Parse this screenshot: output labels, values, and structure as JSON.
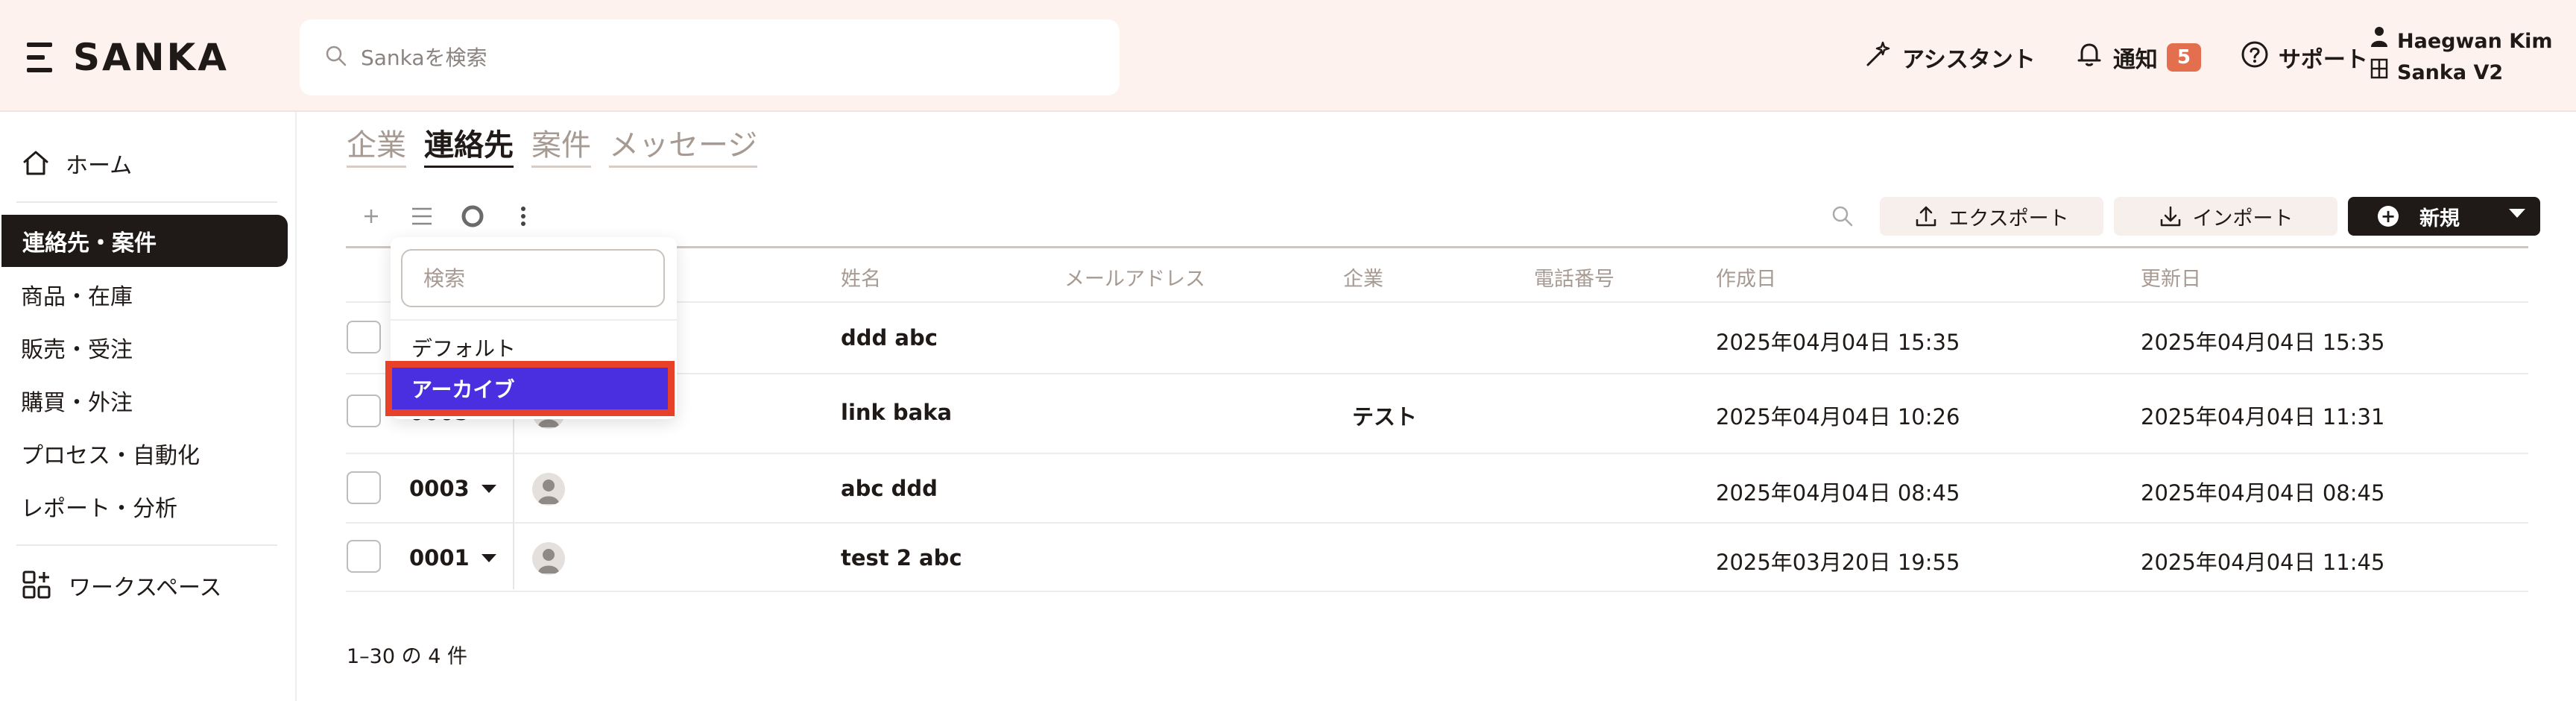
{
  "app": {
    "logo_text": "SANKA"
  },
  "header": {
    "search_placeholder": "Sankaを検索",
    "assistant_label": "アシスタント",
    "notifications_label": "通知",
    "notifications_count": "5",
    "support_label": "サポート",
    "user_name": "Haegwan Kim",
    "workspace_name": "Sanka V2"
  },
  "sidebar": {
    "items": [
      {
        "label": "ホーム"
      },
      {
        "label": "連絡先・案件"
      },
      {
        "label": "商品・在庫"
      },
      {
        "label": "販売・受注"
      },
      {
        "label": "購買・外注"
      },
      {
        "label": "プロセス・自動化"
      },
      {
        "label": "レポート・分析"
      },
      {
        "label": "ワークスペース"
      }
    ]
  },
  "tabs": [
    {
      "label": "企業"
    },
    {
      "label": "連絡先"
    },
    {
      "label": "案件"
    },
    {
      "label": "メッセージ"
    }
  ],
  "toolbar": {
    "export_label": "エクスポート",
    "import_label": "インポート",
    "new_label": "新規"
  },
  "table": {
    "columns": [
      "姓名",
      "メールアドレス",
      "企業",
      "電話番号",
      "作成日",
      "更新日"
    ],
    "rows": [
      {
        "id": "",
        "name": "ddd abc",
        "email": "",
        "company": "",
        "phone": "",
        "created": "2025年04月04日 15:35",
        "updated": "2025年04月04日 15:35"
      },
      {
        "id": "0005",
        "name": "link baka",
        "email": "",
        "company": "テスト",
        "phone": "",
        "created": "2025年04月04日 10:26",
        "updated": "2025年04月04日 11:31"
      },
      {
        "id": "0003",
        "name": "abc ddd",
        "email": "",
        "company": "",
        "phone": "",
        "created": "2025年04月04日 08:45",
        "updated": "2025年04月04日 08:45"
      },
      {
        "id": "0001",
        "name": "test 2 abc",
        "email": "",
        "company": "",
        "phone": "",
        "created": "2025年03月20日 19:55",
        "updated": "2025年04月04日 11:45"
      }
    ],
    "pager": "1–30 の 4 件"
  },
  "view_dropdown": {
    "search_placeholder": "検索",
    "options": [
      {
        "label": "デフォルト"
      },
      {
        "label": "アーカイブ",
        "highlighted": true
      }
    ]
  },
  "colors": {
    "header_bg": "#fdf2ee",
    "active_nav_bg": "#1f1a17",
    "badge": "#e36f4f",
    "highlight_fill": "#4a2fe0",
    "highlight_border": "#e8412a"
  }
}
